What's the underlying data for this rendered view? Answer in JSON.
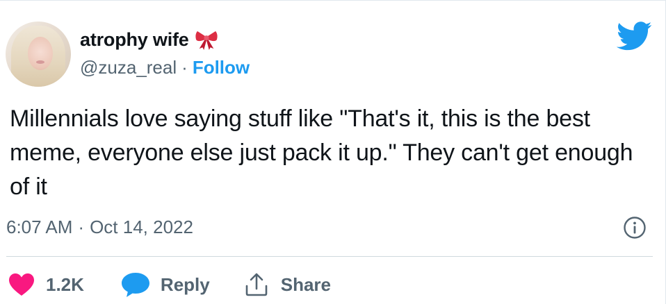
{
  "author": {
    "display_name": "atrophy wife",
    "handle": "@zuza_real",
    "separator": "·",
    "follow_label": "Follow"
  },
  "tweet": {
    "text": "Millennials love saying stuff like \"That's it, this is the best meme, everyone else just pack it up.\" They can't get enough of it",
    "time": "6:07 AM",
    "separator": "·",
    "date": "Oct 14, 2022"
  },
  "actions": {
    "like_count": "1.2K",
    "reply_label": "Reply",
    "share_label": "Share"
  },
  "icons": {
    "brand": "twitter-bird-icon",
    "emoji": "ribbon-bow-icon",
    "info": "info-icon",
    "like": "heart-icon",
    "reply": "speech-bubble-icon",
    "share": "share-arrow-icon"
  },
  "colors": {
    "brand_blue": "#1d9bf0",
    "like_red": "#f91880",
    "secondary_text": "#536471",
    "primary_text": "#0f1419",
    "bow_red": "#dd2e44"
  }
}
